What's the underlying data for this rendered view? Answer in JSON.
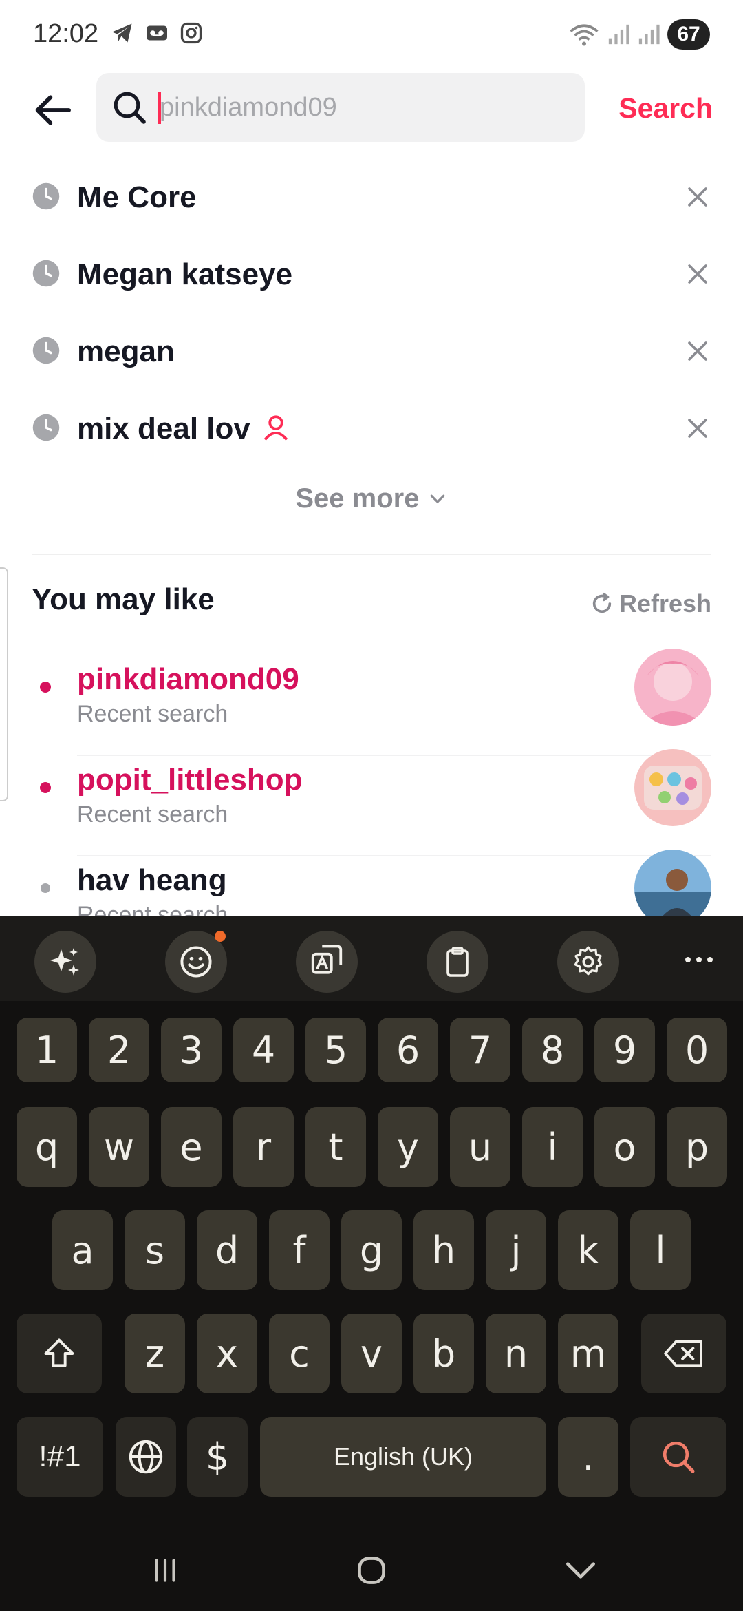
{
  "status_bar": {
    "time": "12:02",
    "battery": "67"
  },
  "search": {
    "placeholder": "pinkdiamond09",
    "submit_label": "Search"
  },
  "history": [
    {
      "label": "Me Core",
      "is_user": false
    },
    {
      "label": "Megan katseye",
      "is_user": false
    },
    {
      "label": "megan",
      "is_user": false
    },
    {
      "label": "mix deal lov",
      "is_user": true
    }
  ],
  "see_more_label": "See more",
  "you_may_like": {
    "title": "You may like",
    "refresh_label": "Refresh",
    "items": [
      {
        "name": "pinkdiamond09",
        "sub": "Recent search",
        "highlight": true
      },
      {
        "name": "popit_littleshop",
        "sub": "Recent search",
        "highlight": true
      },
      {
        "name": "hav heang",
        "sub": "Recent search",
        "highlight": false
      }
    ]
  },
  "keyboard": {
    "row_numbers": [
      "1",
      "2",
      "3",
      "4",
      "5",
      "6",
      "7",
      "8",
      "9",
      "0"
    ],
    "row_top": [
      "q",
      "w",
      "e",
      "r",
      "t",
      "y",
      "u",
      "i",
      "o",
      "p"
    ],
    "row_middle": [
      "a",
      "s",
      "d",
      "f",
      "g",
      "h",
      "j",
      "k",
      "l"
    ],
    "row_bottom": [
      "z",
      "x",
      "c",
      "v",
      "b",
      "n",
      "m"
    ],
    "symbols_label": "!#1",
    "currency_label": "$",
    "space_label": "English (UK)",
    "period_label": "."
  },
  "colors": {
    "accent": "#fe2c55",
    "suggestion_highlight": "#d6115c",
    "keyboard_bg": "#121110",
    "key_bg": "#3b382f"
  }
}
